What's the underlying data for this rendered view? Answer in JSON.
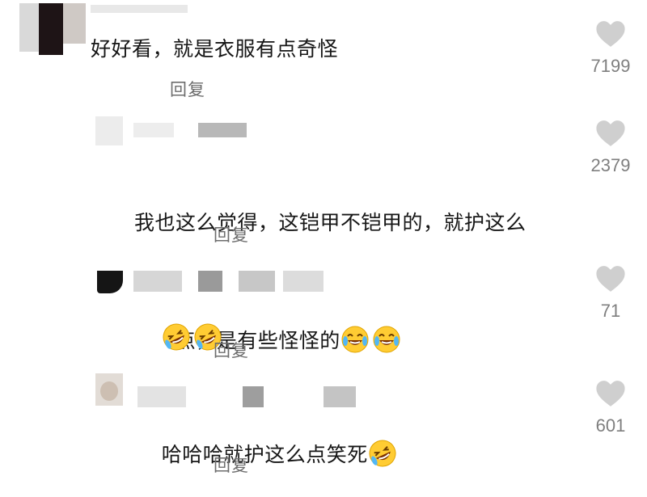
{
  "comments": [
    {
      "text": "好好看，就是衣服有点奇怪",
      "reply_label": "回复",
      "like_icon": "heart-icon",
      "like_count": "7199"
    },
    {
      "text_line1": "我也这么觉得，这铠甲不铠甲的，就护这么",
      "text_line2": "点，是有些怪怪的",
      "emojis": [
        "laughing-crying-emoji",
        "laughing-crying-emoji"
      ],
      "reply_label": "回复",
      "like_icon": "heart-icon",
      "like_count": "2379"
    },
    {
      "text": "",
      "emojis": [
        "rofl-emoji",
        "rofl-emoji"
      ],
      "reply_label": "回复",
      "like_icon": "heart-icon",
      "like_count": "71"
    },
    {
      "text": "哈哈哈就护这么点笑死",
      "emojis": [
        "rofl-emoji"
      ],
      "reply_label": "回复",
      "like_icon": "heart-icon",
      "like_count": "601"
    }
  ],
  "colors": {
    "heart": "#cfcfcf",
    "count_text": "#7f7f7f",
    "reply_text": "#6d6d6d",
    "comment_text": "#161616",
    "emoji_face": "#ffcc33"
  }
}
